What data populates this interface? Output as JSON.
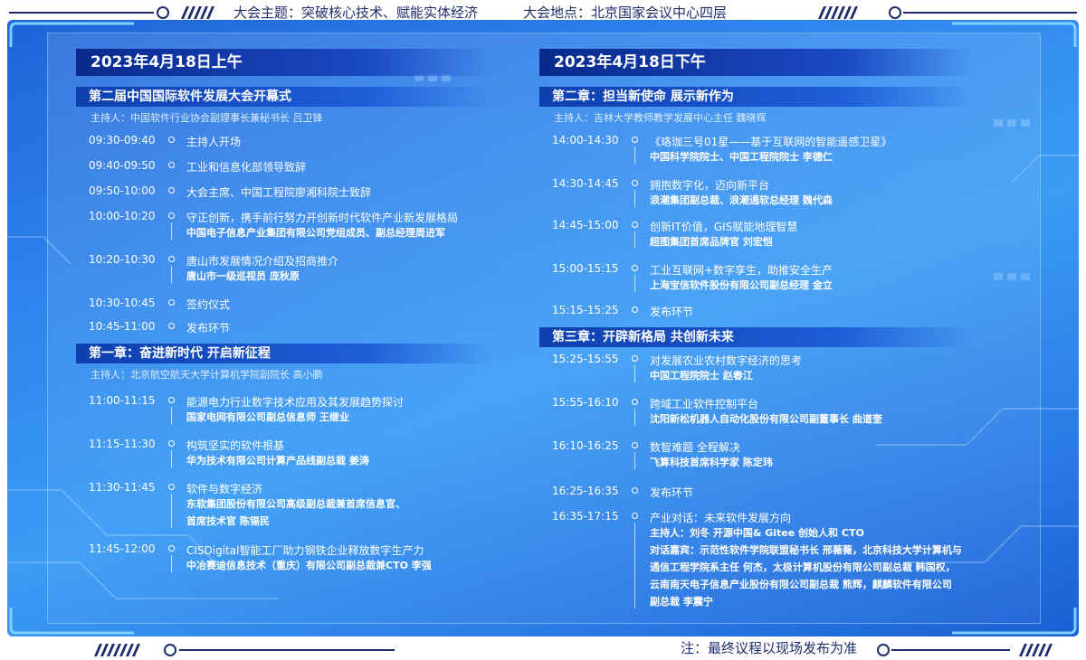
{
  "topbar": {
    "theme": "大会主题：突破核心技术、赋能实体经济",
    "venue": "大会地点：北京国家会议中心四层"
  },
  "colors": {
    "panel": "#2f86ee",
    "header_dark": "#0a2a8c",
    "text": "#ffffff"
  },
  "left": {
    "date": "2023年4月18日上午",
    "sections": [
      {
        "title": "第二届中国国际软件发展大会开幕式",
        "host": "主持人：中国软件行业协会副理事长兼秘书长 吕卫锋",
        "items": [
          {
            "time": "09:30-09:40",
            "title": "主持人开场",
            "subs": []
          },
          {
            "time": "09:40-09:50",
            "title": "工业和信息化部领导致辞",
            "subs": []
          },
          {
            "time": "09:50-10:00",
            "title": "大会主席、中国工程院廖湘科院士致辞",
            "subs": []
          },
          {
            "time": "10:00-10:20",
            "title": "守正创新，携手前行努力开创新时代软件产业新发展格局",
            "subs": [
              "中国电子信息产业集团有限公司党组成员、副总经理周进军"
            ]
          },
          {
            "time": "10:20-10:30",
            "title": "唐山市发展情况介绍及招商推介",
            "subs": [
              "唐山市一级巡视员 庞秋原"
            ]
          },
          {
            "time": "10:30-10:45",
            "title": "签约仪式",
            "subs": []
          },
          {
            "time": "10:45-11:00",
            "title": "发布环节",
            "subs": []
          }
        ]
      },
      {
        "title": "第一章：奋进新时代 开启新征程",
        "host": "主持人：北京航空航天大学计算机学院副院长 高小鹏",
        "items": [
          {
            "time": "11:00-11:15",
            "title": "能源电力行业数字技术应用及其发展趋势探讨",
            "subs": [
              "国家电网有限公司副总信息师 王继业"
            ]
          },
          {
            "time": "11:15-11:30",
            "title": "构筑坚实的软件根基",
            "subs": [
              "华为技术有限公司计算产品线副总裁 姜涛"
            ]
          },
          {
            "time": "11:30-11:45",
            "title": "软件与数字经济",
            "subs": [
              "东软集团股份有限公司高级副总裁兼首席信息官、",
              "首席技术官 陈锡民"
            ]
          },
          {
            "time": "11:45-12:00",
            "title": "CISDigital智能工厂助力钢铁企业释放数字生产力",
            "subs": [
              "中冶赛迪信息技术（重庆）有限公司副总裁兼CTO 李强"
            ]
          }
        ]
      }
    ]
  },
  "right": {
    "date": "2023年4月18日下午",
    "sections": [
      {
        "title": "第二章：担当新使命 展示新作为",
        "host": "主持人：吉林大学教师教学发展中心主任 魏晓辉",
        "items": [
          {
            "time": "14:00-14:30",
            "title": "《珞珈三号01星——基于互联网的智能遥感卫星》",
            "subs": [
              "中国科学院院士、中国工程院院士 李德仁"
            ]
          },
          {
            "time": "14:30-14:45",
            "title": "拥抱数字化，迈向新平台",
            "subs": [
              "浪潮集团副总裁、浪潮通软总经理 魏代森"
            ]
          },
          {
            "time": "14:45-15:00",
            "title": "创新IT价值，GIS赋能地理智慧",
            "subs": [
              "超图集团首席品牌官 刘宏恺"
            ]
          },
          {
            "time": "15:00-15:15",
            "title": "工业互联网+数字孪生，助推安全生产",
            "subs": [
              "上海宝信软件股份有限公司副总经理 金立"
            ]
          },
          {
            "time": "15:15-15:25",
            "title": "发布环节",
            "subs": []
          }
        ]
      },
      {
        "title": "第三章：开辟新格局 共创新未来",
        "host": "",
        "items": [
          {
            "time": "15:25-15:55",
            "title": "对发展农业农村数字经济的思考",
            "subs": [
              "中国工程院院士 赵春江"
            ]
          },
          {
            "time": "15:55-16:10",
            "title": "跨域工业软件控制平台",
            "subs": [
              "沈阳新松机器人自动化股份有限公司副董事长  曲道奎"
            ]
          },
          {
            "time": "16:10-16:25",
            "title": "数智难题 全程解决",
            "subs": [
              "飞算科技首席科学家 陈定玮"
            ]
          },
          {
            "time": "16:25-16:35",
            "title": "发布环节",
            "subs": []
          },
          {
            "time": "16:35-17:15",
            "title": "产业对话：未来软件发展方向",
            "subs": [
              "主持人：刘冬 开源中国& Gitee 创始人和 CTO",
              "对话嘉宾：示范性软件学院联盟秘书长  邢薇薇，北京科技大学计算机与",
              "通信工程学院系主任 何杰，太极计算机股份有限公司副总裁 韩国权，",
              "云南南天电子信息产业股份有限公司副总裁 熊辉，麒麟软件有限公司",
              "副总裁 李震宁"
            ]
          }
        ]
      }
    ]
  },
  "footer": {
    "note": "注：最终议程以现场发布为准"
  }
}
